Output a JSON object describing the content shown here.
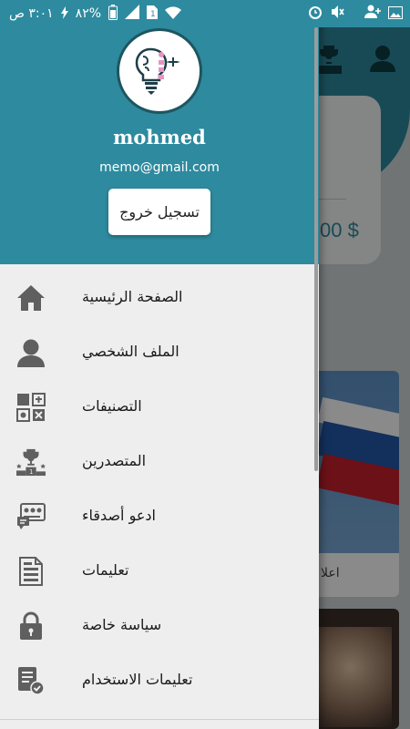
{
  "status_bar": {
    "time": "٣:٠١ ص",
    "battery": "%٨٢",
    "icons": [
      "photo-icon",
      "add-user-icon",
      "mute-icon",
      "alarm-icon",
      "sim-icon",
      "wifi-icon",
      "signal-icon",
      "battery-icon"
    ]
  },
  "drawer": {
    "logo_icon": "quiz-lightbulb-logo",
    "user_name": "mohmed",
    "user_email": "memo@gmail.com",
    "logout_label": "تسجيل خروج",
    "items": [
      {
        "label": "الصفحة الرئيسية",
        "icon": "home-icon"
      },
      {
        "label": "الملف الشخصي",
        "icon": "profile-icon"
      },
      {
        "label": "التصنيفات",
        "icon": "categories-icon"
      },
      {
        "label": "المتصدرين",
        "icon": "leaderboard-icon"
      },
      {
        "label": "ادعو أصدقاء",
        "icon": "invite-friends-icon"
      },
      {
        "label": "تعليمات",
        "icon": "instructions-icon"
      },
      {
        "label": "سياسة خاصة",
        "icon": "lock-icon"
      },
      {
        "label": "تعليمات الاستخدام",
        "icon": "terms-icon"
      }
    ]
  },
  "background": {
    "price_text": "00 $",
    "tile_caption": "اعلا"
  },
  "colors": {
    "primary": "#2e8a9e",
    "drawer_bg": "#eeeeee",
    "icon_gray": "#5f5f5f"
  }
}
